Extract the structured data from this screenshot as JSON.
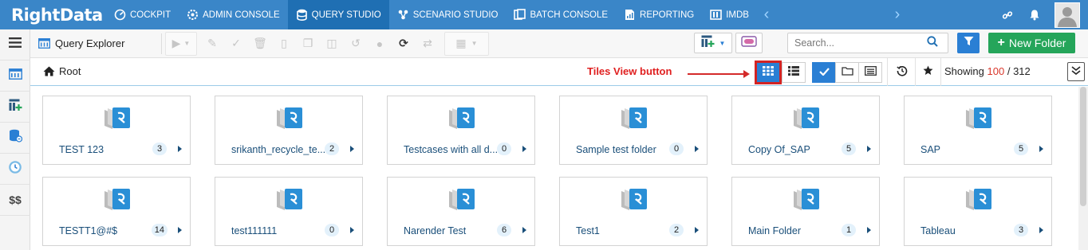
{
  "app": {
    "brand": "RightData"
  },
  "nav": {
    "items": [
      {
        "label": "COCKPIT"
      },
      {
        "label": "ADMIN CONSOLE"
      },
      {
        "label": "QUERY STUDIO"
      },
      {
        "label": "SCENARIO STUDIO"
      },
      {
        "label": "BATCH CONSOLE"
      },
      {
        "label": "REPORTING"
      },
      {
        "label": "IMDB"
      }
    ],
    "active": "QUERY STUDIO"
  },
  "sidebar": {
    "items": [
      {
        "icon": "hamburger-menu-icon"
      },
      {
        "icon": "query-explorer-icon"
      },
      {
        "icon": "layout-add-icon"
      },
      {
        "icon": "database-icon"
      },
      {
        "icon": "clock-badge-icon"
      },
      {
        "label": "$$"
      }
    ]
  },
  "toolbar": {
    "title": "Query Explorer",
    "search_placeholder": "Search...",
    "new_folder_label": "New Folder"
  },
  "breadcrumb": {
    "root": "Root"
  },
  "annotation": {
    "text": "Tiles View button"
  },
  "showing": {
    "prefix": "Showing",
    "count": "100",
    "total": "312",
    "sep": "/"
  },
  "tiles": [
    {
      "name": "TEST 123",
      "count": "3"
    },
    {
      "name": "srikanth_recycle_te...",
      "count": "2"
    },
    {
      "name": "Testcases with all d...",
      "count": "0"
    },
    {
      "name": "Sample test folder",
      "count": "0"
    },
    {
      "name": "Copy Of_SAP",
      "count": "5"
    },
    {
      "name": "SAP",
      "count": "5"
    },
    {
      "name": "TESTT1@#$",
      "count": "14"
    },
    {
      "name": "test111111",
      "count": "0"
    },
    {
      "name": "Narender Test",
      "count": "6"
    },
    {
      "name": "Test1",
      "count": "2"
    },
    {
      "name": "Main Folder",
      "count": "1"
    },
    {
      "name": "Tableau",
      "count": "3"
    }
  ],
  "colors": {
    "nav_bg": "#3a86c8",
    "nav_active": "#1f6fb3",
    "accent_blue": "#2a7fd4",
    "new_folder_green": "#25a55a",
    "annotation_red": "#e02020",
    "tile_text": "#1a4f7a"
  }
}
